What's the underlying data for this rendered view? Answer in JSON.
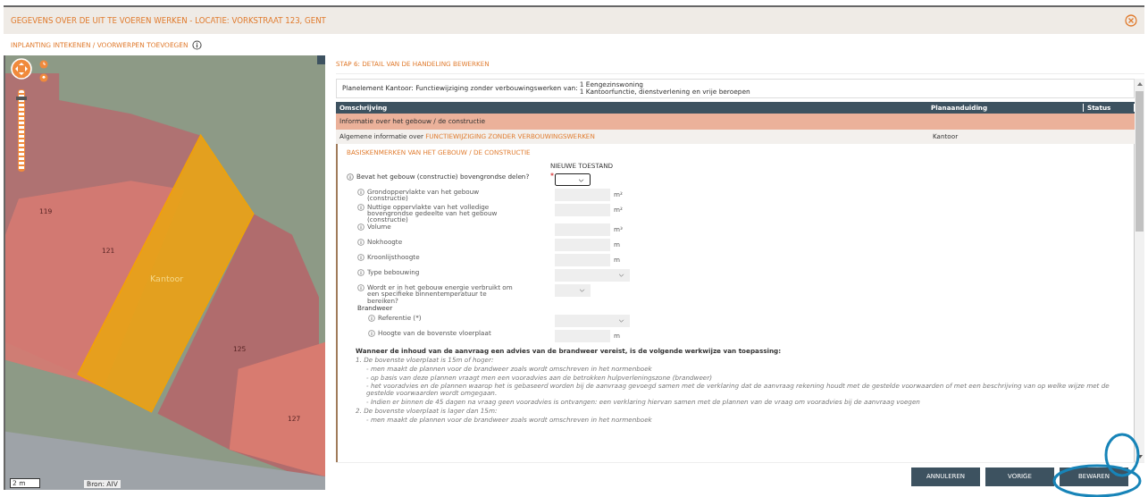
{
  "window": {
    "title": "GEGEVENS OVER DE UIT TE VOEREN WERKEN - LOCATIE: VORKSTRAAT 123, GENT"
  },
  "subheader": {
    "title": "INPLANTING INTEKENEN / VOORWERPEN TOEVOEGEN"
  },
  "map": {
    "zoom": {
      "level": 0.92
    },
    "parcel_numbers": [
      "119",
      "121",
      "125",
      "127"
    ],
    "highlight_label": "Kantoor",
    "scale": "2 m",
    "source": "Bron: AIV"
  },
  "step": {
    "title": "STAP 6: DETAIL VAN DE HANDELING BEWERKEN"
  },
  "planelement": {
    "label": "Planelement Kantoor: Functiewijziging zonder verbouwingswerken van:",
    "values": [
      "1 Eengezinswoning",
      "1 Kantoorfunctie, dienstverlening en vrije beroepen"
    ]
  },
  "table": {
    "columns": [
      "Omschrijving",
      "Planaanduiding",
      "Status"
    ],
    "group_row": "Informatie over het gebouw / de constructie",
    "row": {
      "prefix": "Algemene informatie over",
      "highlight": "FUNCTIEWIJZIGING ZONDER VERBOUWINGSWERKEN",
      "planaanduiding": "Kantoor"
    }
  },
  "section": {
    "title": "BASISKENMERKEN VAN HET GEBOUW / DE CONSTRUCTIE",
    "column_header": "NIEUWE TOESTAND",
    "questions": [
      {
        "label": "Bevat het gebouw (constructie) bovengrondse delen?",
        "kind": "choice",
        "required_mark": "*",
        "focused": true,
        "children": [
          {
            "label": "Grondoppervlakte van het gebouw (constructie)",
            "kind": "input",
            "unit": "m²"
          },
          {
            "label": "Nuttige oppervlakte van het volledige bovengrondse gedeelte van het gebouw (constructie)",
            "kind": "input",
            "unit": "m²"
          },
          {
            "label": "Volume",
            "kind": "input",
            "unit": "m³"
          },
          {
            "label": "Nokhoogte",
            "kind": "input",
            "unit": "m"
          },
          {
            "label": "Kroonlijsthoogte",
            "kind": "input",
            "unit": "m"
          },
          {
            "label": "Type bebouwing",
            "kind": "select"
          },
          {
            "label": "Wordt er in het gebouw energie verbruikt om een specifieke binnentemperatuur te bereiken?",
            "kind": "choice"
          },
          {
            "label": "Brandweer",
            "kind": "group",
            "children": [
              {
                "label": "Referentie (*)",
                "kind": "select"
              },
              {
                "label": "Hoogte van de bovenste vloerplaat",
                "kind": "input",
                "unit": "m"
              }
            ]
          }
        ]
      }
    ],
    "notice": {
      "heading": "Wanneer de inhoud van de aanvraag een advies van de brandweer vereist, is de volgende werkwijze van toepassing:",
      "items": [
        {
          "title": "1. De bovenste vloerplaat is 15m of hoger:",
          "bullets": [
            "- men maakt de plannen voor de brandweer zoals wordt omschreven in het normenboek",
            "- op basis van deze plannen vraagt men een vooradvies aan de betrokken hulpverleningszone (brandweer)",
            "- het vooradvies en de plannen waarop het is gebaseerd worden bij de aanvraag gevoegd samen met de verklaring dat de aanvraag rekening houdt met de gestelde voorwaarden of met een beschrijving van op welke wijze met de gestelde voorwaarden wordt omgegaan.",
            "- Indien er binnen de 45 dagen na vraag geen vooradvies is ontvangen: een verklaring hiervan samen met de plannen van de vraag om vooradvies bij de aanvraag voegen"
          ]
        },
        {
          "title": "2. De bovenste vloerplaat is lager dan 15m:",
          "bullets": [
            "- men maakt de plannen voor de brandweer zoals wordt omschreven in het normenboek"
          ]
        }
      ]
    }
  },
  "buttons": [
    "ANNULEREN",
    "VORIGE",
    "BEWAREN"
  ]
}
